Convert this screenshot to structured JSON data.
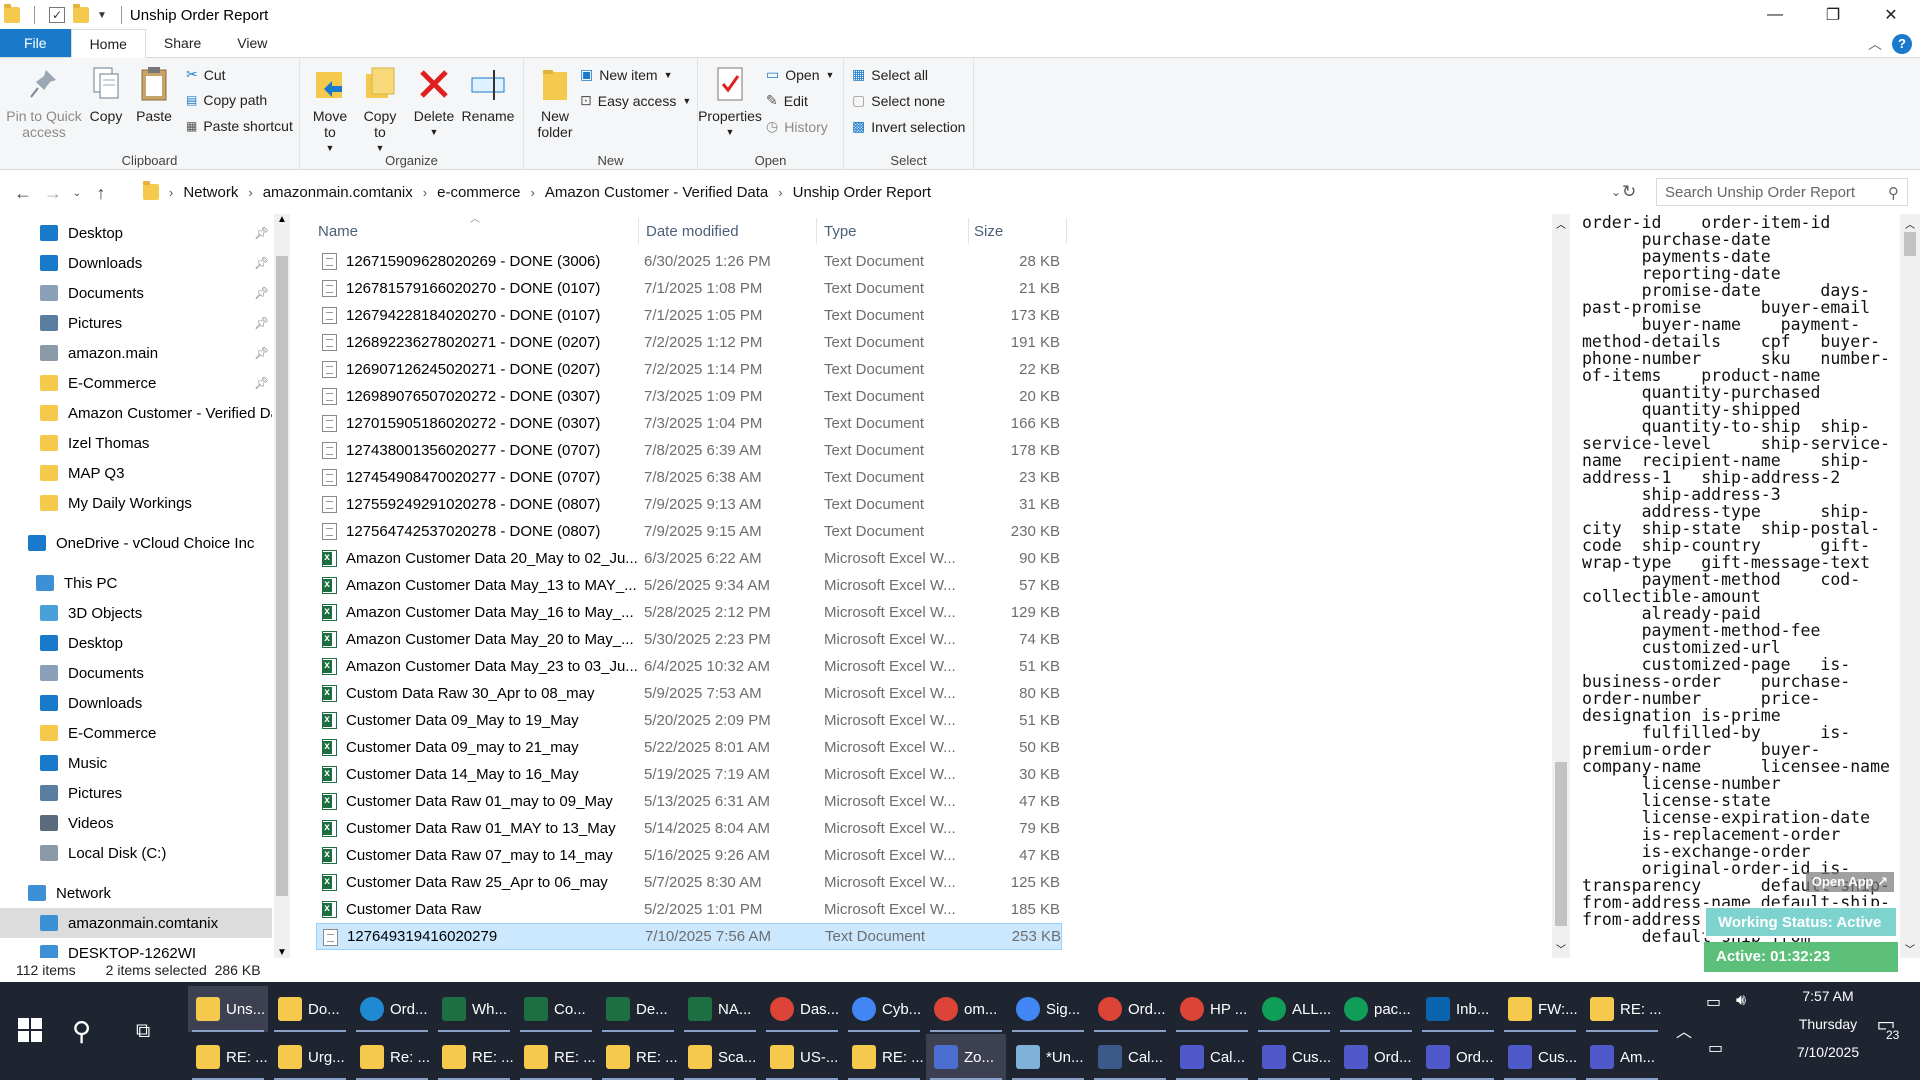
{
  "window": {
    "title": "Unship Order Report"
  },
  "ribbon_tabs": [
    "File",
    "Home",
    "Share",
    "View"
  ],
  "ribbon": {
    "clipboard": {
      "label": "Clipboard",
      "pin": "Pin to Quick access",
      "copy": "Copy",
      "paste": "Paste",
      "cut": "Cut",
      "copy_path": "Copy path",
      "paste_shortcut": "Paste shortcut"
    },
    "organize": {
      "label": "Organize",
      "move_to": "Move to",
      "copy_to": "Copy to",
      "delete": "Delete",
      "rename": "Rename"
    },
    "new": {
      "label": "New",
      "new_folder": "New folder",
      "new_item": "New item",
      "easy_access": "Easy access"
    },
    "open": {
      "label": "Open",
      "properties": "Properties",
      "open": "Open",
      "edit": "Edit",
      "history": "History"
    },
    "select": {
      "label": "Select",
      "select_all": "Select all",
      "select_none": "Select none",
      "invert": "Invert selection"
    }
  },
  "breadcrumb": [
    "Network",
    "amazonmain.comtanix",
    "e-commerce",
    "Amazon Customer - Verified Data",
    "Unship Order Report"
  ],
  "search": {
    "placeholder": "Search Unship Order Report"
  },
  "nav": [
    {
      "label": "Desktop",
      "icon": "desktop-icon",
      "pinned": true
    },
    {
      "label": "Downloads",
      "icon": "downloads-icon",
      "pinned": true
    },
    {
      "label": "Documents",
      "icon": "documents-icon",
      "pinned": true
    },
    {
      "label": "Pictures",
      "icon": "pictures-icon",
      "pinned": true
    },
    {
      "label": "amazon.main",
      "icon": "network-drive-icon",
      "pinned": true
    },
    {
      "label": "E-Commerce",
      "icon": "folder-icon",
      "pinned": true
    },
    {
      "label": "Amazon Customer - Verified Da",
      "icon": "folder-icon",
      "pinned": false
    },
    {
      "label": "Izel Thomas",
      "icon": "folder-icon",
      "pinned": false
    },
    {
      "label": "MAP Q3",
      "icon": "folder-icon",
      "pinned": false
    },
    {
      "label": "My Daily Workings",
      "icon": "folder-icon",
      "pinned": false
    },
    {
      "label": "OneDrive - vCloud Choice Inc",
      "icon": "onedrive-icon",
      "pinned": false
    },
    {
      "label": "This PC",
      "icon": "computer-icon",
      "pinned": false
    },
    {
      "label": "3D Objects",
      "icon": "3d-objects-icon",
      "pinned": false
    },
    {
      "label": "Desktop",
      "icon": "desktop-icon",
      "pinned": false
    },
    {
      "label": "Documents",
      "icon": "documents-icon",
      "pinned": false
    },
    {
      "label": "Downloads",
      "icon": "downloads-icon",
      "pinned": false
    },
    {
      "label": "E-Commerce",
      "icon": "folder-icon",
      "pinned": false
    },
    {
      "label": "Music",
      "icon": "music-icon",
      "pinned": false
    },
    {
      "label": "Pictures",
      "icon": "pictures-icon",
      "pinned": false
    },
    {
      "label": "Videos",
      "icon": "videos-icon",
      "pinned": false
    },
    {
      "label": "Local Disk (C:)",
      "icon": "disk-icon",
      "pinned": false
    },
    {
      "label": "Network",
      "icon": "network-icon",
      "pinned": false
    },
    {
      "label": "amazonmain.comtanix",
      "icon": "computer-icon",
      "pinned": false,
      "selected": true
    },
    {
      "label": "DESKTOP-1262WI",
      "icon": "computer-icon",
      "pinned": false
    }
  ],
  "columns": [
    "Name",
    "Date modified",
    "Type",
    "Size"
  ],
  "files": [
    {
      "name": "126715909628020269 - DONE (3006)",
      "date": "6/30/2025 1:26 PM",
      "type": "Text Document",
      "size": "28 KB",
      "kind": "txt"
    },
    {
      "name": "126781579166020270 - DONE (0107)",
      "date": "7/1/2025 1:08 PM",
      "type": "Text Document",
      "size": "21 KB",
      "kind": "txt"
    },
    {
      "name": "126794228184020270 - DONE (0107)",
      "date": "7/1/2025 1:05 PM",
      "type": "Text Document",
      "size": "173 KB",
      "kind": "txt"
    },
    {
      "name": "126892236278020271 - DONE (0207)",
      "date": "7/2/2025 1:12 PM",
      "type": "Text Document",
      "size": "191 KB",
      "kind": "txt"
    },
    {
      "name": "126907126245020271 - DONE (0207)",
      "date": "7/2/2025 1:14 PM",
      "type": "Text Document",
      "size": "22 KB",
      "kind": "txt"
    },
    {
      "name": "126989076507020272 - DONE (0307)",
      "date": "7/3/2025 1:09 PM",
      "type": "Text Document",
      "size": "20 KB",
      "kind": "txt"
    },
    {
      "name": "127015905186020272 - DONE (0307)",
      "date": "7/3/2025 1:04 PM",
      "type": "Text Document",
      "size": "166 KB",
      "kind": "txt"
    },
    {
      "name": "127438001356020277 - DONE (0707)",
      "date": "7/8/2025 6:39 AM",
      "type": "Text Document",
      "size": "178 KB",
      "kind": "txt"
    },
    {
      "name": "127454908470020277 - DONE (0707)",
      "date": "7/8/2025 6:38 AM",
      "type": "Text Document",
      "size": "23 KB",
      "kind": "txt"
    },
    {
      "name": "127559249291020278 - DONE (0807)",
      "date": "7/9/2025 9:13 AM",
      "type": "Text Document",
      "size": "31 KB",
      "kind": "txt"
    },
    {
      "name": "127564742537020278 - DONE (0807)",
      "date": "7/9/2025 9:15 AM",
      "type": "Text Document",
      "size": "230 KB",
      "kind": "txt"
    },
    {
      "name": "Amazon Customer Data 20_May to 02_Ju...",
      "date": "6/3/2025 6:22 AM",
      "type": "Microsoft Excel W...",
      "size": "90 KB",
      "kind": "xl"
    },
    {
      "name": "Amazon Customer Data May_13 to MAY_...",
      "date": "5/26/2025 9:34 AM",
      "type": "Microsoft Excel W...",
      "size": "57 KB",
      "kind": "xl"
    },
    {
      "name": "Amazon Customer Data May_16 to May_...",
      "date": "5/28/2025 2:12 PM",
      "type": "Microsoft Excel W...",
      "size": "129 KB",
      "kind": "xl"
    },
    {
      "name": "Amazon Customer Data May_20 to May_...",
      "date": "5/30/2025 2:23 PM",
      "type": "Microsoft Excel W...",
      "size": "74 KB",
      "kind": "xl"
    },
    {
      "name": "Amazon Customer Data May_23 to 03_Ju...",
      "date": "6/4/2025 10:32 AM",
      "type": "Microsoft Excel W...",
      "size": "51 KB",
      "kind": "xl"
    },
    {
      "name": "Custom Data Raw 30_Apr to 08_may",
      "date": "5/9/2025 7:53 AM",
      "type": "Microsoft Excel W...",
      "size": "80 KB",
      "kind": "xl"
    },
    {
      "name": "Customer Data 09_May to 19_May",
      "date": "5/20/2025 2:09 PM",
      "type": "Microsoft Excel W...",
      "size": "51 KB",
      "kind": "xl"
    },
    {
      "name": "Customer Data 09_may to 21_may",
      "date": "5/22/2025 8:01 AM",
      "type": "Microsoft Excel W...",
      "size": "50 KB",
      "kind": "xl"
    },
    {
      "name": "Customer Data 14_May to 16_May",
      "date": "5/19/2025 7:19 AM",
      "type": "Microsoft Excel W...",
      "size": "30 KB",
      "kind": "xl"
    },
    {
      "name": "Customer Data Raw 01_may to 09_May",
      "date": "5/13/2025 6:31 AM",
      "type": "Microsoft Excel W...",
      "size": "47 KB",
      "kind": "xl"
    },
    {
      "name": "Customer Data Raw 01_MAY to 13_May",
      "date": "5/14/2025 8:04 AM",
      "type": "Microsoft Excel W...",
      "size": "79 KB",
      "kind": "xl"
    },
    {
      "name": "Customer Data Raw 07_may to 14_may",
      "date": "5/16/2025 9:26 AM",
      "type": "Microsoft Excel W...",
      "size": "47 KB",
      "kind": "xl"
    },
    {
      "name": "Customer Data Raw 25_Apr to 06_may",
      "date": "5/7/2025 8:30 AM",
      "type": "Microsoft Excel W...",
      "size": "125 KB",
      "kind": "xl"
    },
    {
      "name": "Customer Data Raw",
      "date": "5/2/2025 1:01 PM",
      "type": "Microsoft Excel W...",
      "size": "185 KB",
      "kind": "xl"
    },
    {
      "name": "127649319416020279",
      "date": "7/10/2025 7:56 AM",
      "type": "Text Document",
      "size": "253 KB",
      "kind": "txt",
      "selected": true
    }
  ],
  "preview_text": "order-id    order-item-id\n      purchase-date\n      payments-date\n      reporting-date\n      promise-date      days-\npast-promise      buyer-email\n      buyer-name    payment-\nmethod-details    cpf   buyer-\nphone-number      sku   number-\nof-items    product-name\n      quantity-purchased\n      quantity-shipped\n      quantity-to-ship  ship-\nservice-level     ship-service-\nname  recipient-name    ship-\naddress-1   ship-address-2\n      ship-address-3\n      address-type      ship-\ncity  ship-state  ship-postal-\ncode  ship-country      gift-\nwrap-type   gift-message-text\n      payment-method    cod-\ncollectible-amount\n      already-paid\n      payment-method-fee\n      customized-url\n      customized-page   is-\nbusiness-order    purchase-\norder-number      price-\ndesignation is-prime\n      fulfilled-by      is-\npremium-order     buyer-\ncompany-name      licensee-name\n      license-number\n      license-state\n      license-expiration-date\n      is-replacement-order\n      is-exchange-order\n      original-order-id is-\ntransparency      default-ship-\nfrom-address-name default-ship-\nfrom-address-field-1\n      default-ship-from-",
  "status": {
    "items": "112 items",
    "selected": "2 items selected  286 KB"
  },
  "widget": {
    "open_app": "Open App ↗",
    "working": "Working Status: Active",
    "active": "Active: 01:32:23"
  },
  "taskbar_row1": [
    {
      "label": "Uns...",
      "icon": "file-explorer-icon",
      "color": "#f5c94c",
      "active": true
    },
    {
      "label": "Do...",
      "icon": "file-explorer-icon",
      "color": "#f5c94c"
    },
    {
      "label": "Ord...",
      "icon": "edge-icon",
      "color": "#1f8ad2"
    },
    {
      "label": "Wh...",
      "icon": "excel-icon",
      "color": "#1d6f42"
    },
    {
      "label": "Co...",
      "icon": "excel-icon",
      "color": "#1d6f42"
    },
    {
      "label": "De...",
      "icon": "excel-icon",
      "color": "#1d6f42"
    },
    {
      "label": "NA...",
      "icon": "excel-icon",
      "color": "#1d6f42"
    },
    {
      "label": "Das...",
      "icon": "chrome-icon",
      "color": "#db4437"
    },
    {
      "label": "Cyb...",
      "icon": "chrome-icon",
      "color": "#4285f4"
    },
    {
      "label": "om...",
      "icon": "chrome-icon",
      "color": "#db4437"
    },
    {
      "label": "Sig...",
      "icon": "chrome-icon",
      "color": "#4285f4"
    },
    {
      "label": "Ord...",
      "icon": "chrome-icon",
      "color": "#db4437"
    },
    {
      "label": "HP ...",
      "icon": "chrome-icon",
      "color": "#db4437"
    },
    {
      "label": "ALL...",
      "icon": "chrome-icon",
      "color": "#0f9d58"
    },
    {
      "label": "pac...",
      "icon": "chrome-icon",
      "color": "#0f9d58"
    },
    {
      "label": "Inb...",
      "icon": "outlook-icon",
      "color": "#0a64ad"
    },
    {
      "label": "FW:...",
      "icon": "mail-icon",
      "color": "#f5c94c"
    },
    {
      "label": "RE: ...",
      "icon": "mail-icon",
      "color": "#f5c94c"
    }
  ],
  "taskbar_row2": [
    {
      "label": "RE: ...",
      "icon": "mail-icon",
      "color": "#f5c94c"
    },
    {
      "label": "Urg...",
      "icon": "mail-icon",
      "color": "#f5c94c"
    },
    {
      "label": "Re: ...",
      "icon": "mail-icon",
      "color": "#f5c94c"
    },
    {
      "label": "RE: ...",
      "icon": "mail-icon",
      "color": "#f5c94c"
    },
    {
      "label": "RE: ...",
      "icon": "mail-icon",
      "color": "#f5c94c"
    },
    {
      "label": "RE: ...",
      "icon": "mail-icon",
      "color": "#f5c94c"
    },
    {
      "label": "Sca...",
      "icon": "mail-icon",
      "color": "#f5c94c"
    },
    {
      "label": "US-...",
      "icon": "mail-icon",
      "color": "#f5c94c"
    },
    {
      "label": "RE: ...",
      "icon": "mail-icon",
      "color": "#f5c94c"
    },
    {
      "label": "Zo...",
      "icon": "zoho-icon",
      "color": "#4a6fd0",
      "active": true
    },
    {
      "label": "*Un...",
      "icon": "notepad-icon",
      "color": "#7fb2d9"
    },
    {
      "label": "Cal...",
      "icon": "calculator-icon",
      "color": "#3b5a8a"
    },
    {
      "label": "Cal...",
      "icon": "teams-icon",
      "color": "#5059c9"
    },
    {
      "label": "Cus...",
      "icon": "teams-icon",
      "color": "#5059c9"
    },
    {
      "label": "Ord...",
      "icon": "teams-icon",
      "color": "#5059c9"
    },
    {
      "label": "Ord...",
      "icon": "teams-icon",
      "color": "#5059c9"
    },
    {
      "label": "Cus...",
      "icon": "teams-icon",
      "color": "#5059c9"
    },
    {
      "label": "Am...",
      "icon": "teams-icon",
      "color": "#5059c9"
    }
  ],
  "clock": {
    "time": "7:57 AM",
    "day": "Thursday",
    "date": "7/10/2025"
  },
  "notifications": "23"
}
